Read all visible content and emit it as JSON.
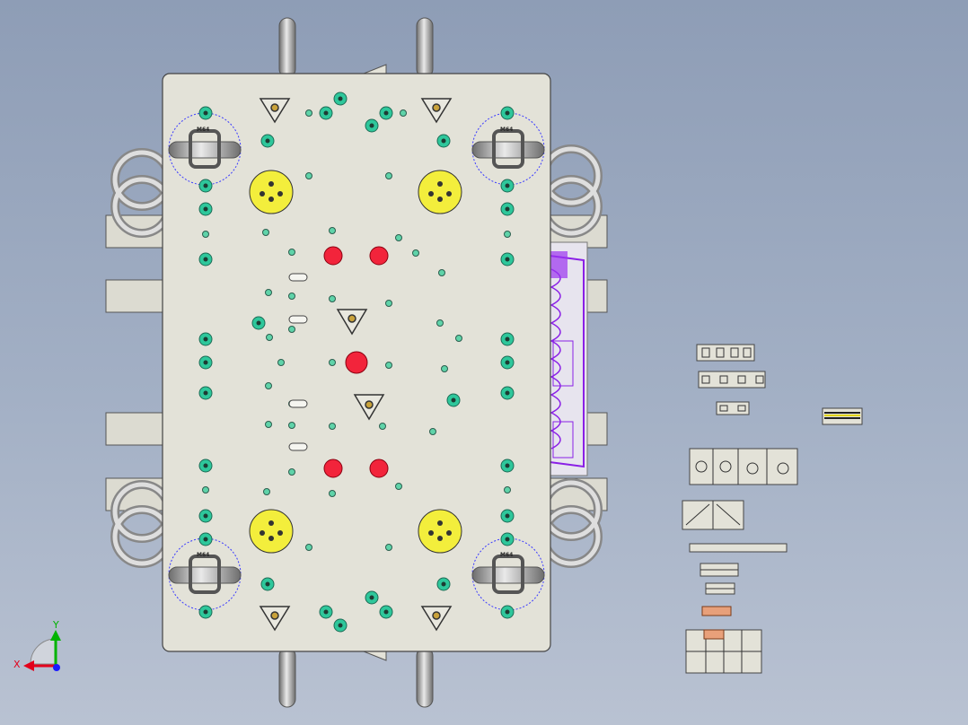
{
  "scene": {
    "background_top": "#8e9db6",
    "background_bottom": "#b9c2d2",
    "plate_color": "#e3e2d8",
    "hole_color": "#2ec79b",
    "pin_color": "#f2243b",
    "insert_color": "#f3ee3c",
    "detail_color": "#8a1fe6",
    "bolt_labels": [
      "M64",
      "M64",
      "M64",
      "M64"
    ]
  },
  "triad": {
    "x_label": "X",
    "y_label": "Y",
    "x_color": "#e3001b",
    "y_color": "#00b300",
    "z_color": "#1a1aff"
  }
}
